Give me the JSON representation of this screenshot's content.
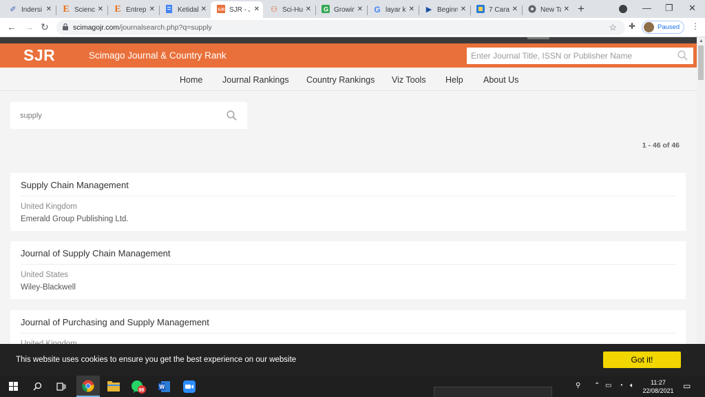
{
  "browser": {
    "tabs": [
      {
        "label": "Indersi",
        "icon": "feather-icon",
        "color": "#3b5bb5"
      },
      {
        "label": "Science",
        "icon": "elsevier-icon",
        "color": "#e9711c"
      },
      {
        "label": "Entrep",
        "icon": "elsevier-icon",
        "color": "#e9711c"
      },
      {
        "label": "Ketidal",
        "icon": "docs-icon",
        "color": "#4285f4"
      },
      {
        "label": "SJR - J",
        "icon": "sjr-icon",
        "color": "#e9703a",
        "active": true
      },
      {
        "label": "Sci-Hub",
        "icon": "scihub-icon",
        "color": "#e94e1b"
      },
      {
        "label": "Growin",
        "icon": "growing-icon",
        "color": "#34a853"
      },
      {
        "label": "layar k",
        "icon": "google-icon",
        "color": "#4285f4"
      },
      {
        "label": "Beginn",
        "icon": "play-icon",
        "color": "#1a4fa0"
      },
      {
        "label": "7 Cara",
        "icon": "article-icon",
        "color": "#2a7bd8"
      },
      {
        "label": "New Ta",
        "icon": "chrome-icon",
        "color": "#5f6368"
      }
    ],
    "url_host": "scimagojr.com",
    "url_path": "/journalsearch.php?q=supply",
    "profile_label": "Paused"
  },
  "site": {
    "logo": "SJR",
    "name": "Scimago Journal & Country Rank",
    "search_placeholder": "Enter Journal Title, ISSN or Publisher Name",
    "accent": "#e9703a",
    "nav": [
      "Home",
      "Journal Rankings",
      "Country Rankings",
      "Viz Tools",
      "Help",
      "About Us"
    ]
  },
  "search": {
    "value": "supply",
    "result_count": "1 - 46 of 46"
  },
  "results": [
    {
      "title": "Supply Chain Management",
      "country": "United Kingdom",
      "publisher": "Emerald Group Publishing Ltd."
    },
    {
      "title": "Journal of Supply Chain Management",
      "country": "United States",
      "publisher": "Wiley-Blackwell"
    },
    {
      "title": "Journal of Purchasing and Supply Management",
      "country": "United Kingdom",
      "publisher": ""
    }
  ],
  "cookie": {
    "text": "This website uses cookies to ensure you get the best experience on our website",
    "button": "Got it!",
    "button_color": "#f1d600"
  },
  "taskbar": {
    "whatsapp_badge": "98",
    "time": "11:27",
    "date": "22/08/2021"
  }
}
